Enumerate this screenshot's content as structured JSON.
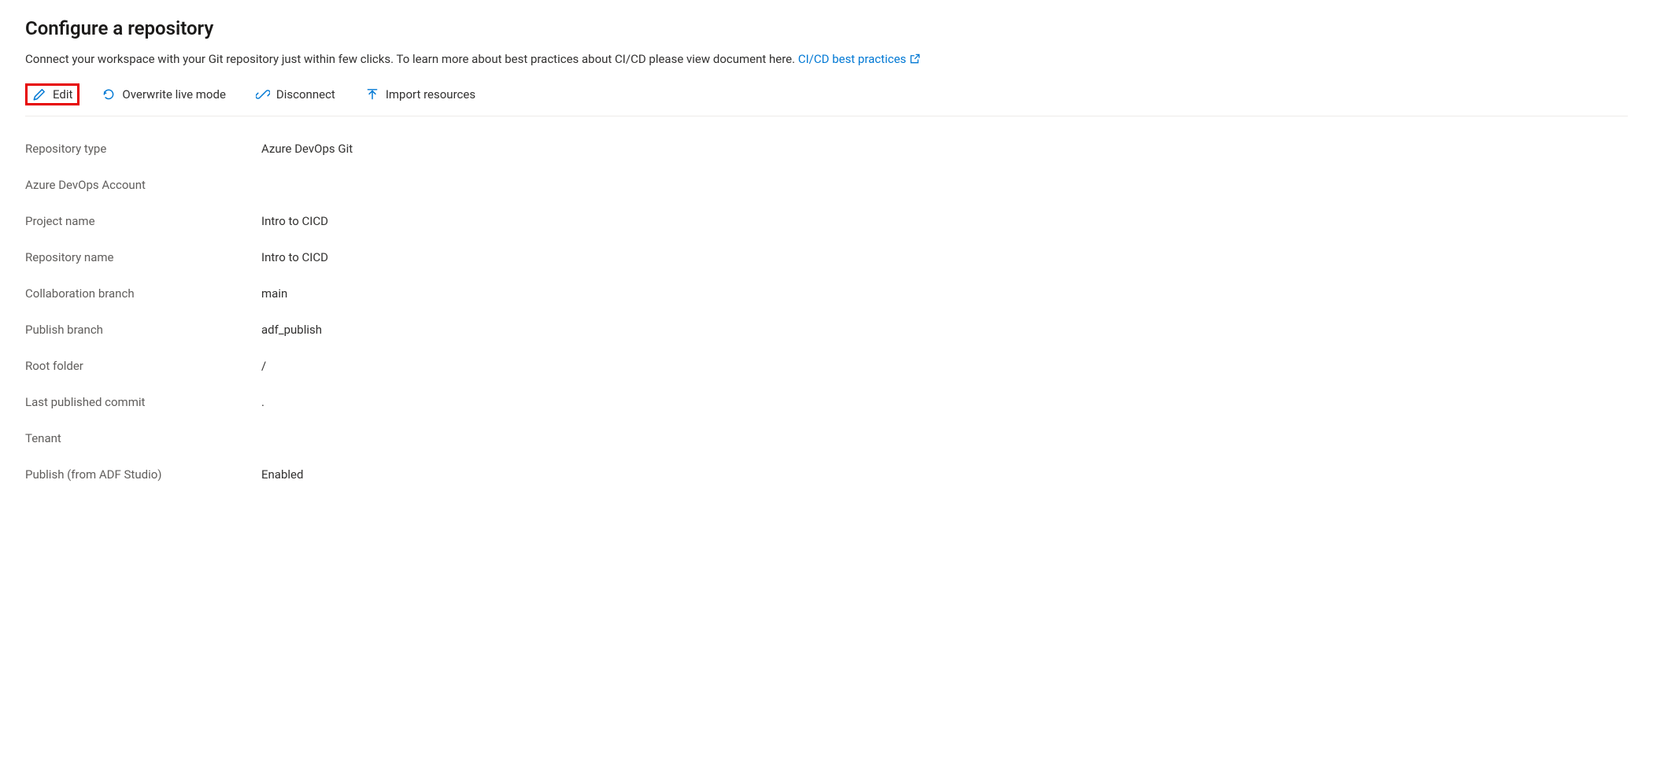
{
  "header": {
    "title": "Configure a repository",
    "description": "Connect your workspace with your Git repository just within few clicks. To learn more about best practices about CI/CD please view document here.",
    "link_label": "CI/CD best practices"
  },
  "toolbar": {
    "edit_label": "Edit",
    "overwrite_label": "Overwrite live mode",
    "disconnect_label": "Disconnect",
    "import_label": "Import resources"
  },
  "details": [
    {
      "label": "Repository type",
      "value": "Azure DevOps Git"
    },
    {
      "label": "Azure DevOps Account",
      "value": ""
    },
    {
      "label": "Project name",
      "value": "Intro to CICD"
    },
    {
      "label": "Repository name",
      "value": "Intro to CICD"
    },
    {
      "label": "Collaboration branch",
      "value": "main"
    },
    {
      "label": "Publish branch",
      "value": "adf_publish"
    },
    {
      "label": "Root folder",
      "value": "/"
    },
    {
      "label": "Last published commit",
      "value": "."
    },
    {
      "label": "Tenant",
      "value": ""
    },
    {
      "label": "Publish (from ADF Studio)",
      "value": "Enabled"
    }
  ]
}
